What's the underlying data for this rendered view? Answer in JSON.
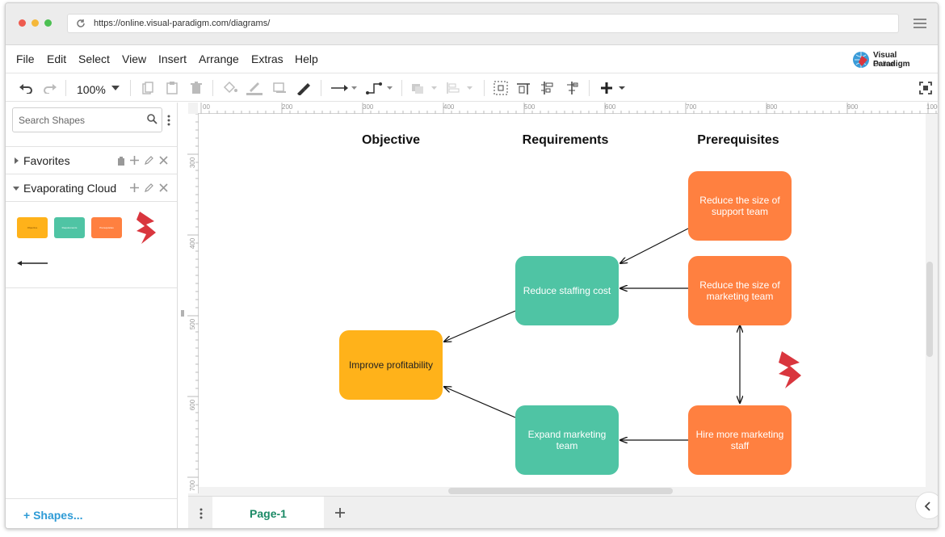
{
  "browser": {
    "url": "https://online.visual-paradigm.com/diagrams/",
    "dots": [
      "#ee5b4f",
      "#f5b83a",
      "#4cc052"
    ]
  },
  "menu": {
    "items": [
      "File",
      "Edit",
      "Select",
      "View",
      "Insert",
      "Arrange",
      "Extras",
      "Help"
    ],
    "logo_line1": "Visual Paradigm",
    "logo_line2": "Online"
  },
  "toolbar": {
    "zoom": "100%"
  },
  "sidebar": {
    "search_placeholder": "Search Shapes",
    "favorites_label": "Favorites",
    "group_label": "Evaporating Cloud",
    "thumb_labels": [
      "Objective",
      "Requirements",
      "Prerequisites"
    ],
    "shapes_link": "+ Shapes..."
  },
  "ruler": {
    "h_labels": [
      "00",
      "200",
      "300",
      "400",
      "500",
      "600",
      "700",
      "800",
      "900",
      "1000"
    ],
    "v_labels": [
      "300",
      "400",
      "500",
      "600",
      "700"
    ]
  },
  "diagram": {
    "headers": {
      "objective": "Objective",
      "requirements": "Requirements",
      "prerequisites": "Prerequisites"
    },
    "nodes": {
      "improve": "Improve profitability",
      "reduce_staffing": "Reduce staffing cost",
      "expand_marketing": "Expand marketing team",
      "reduce_support": "Reduce the size of support team",
      "reduce_marketing": "Reduce the size of marketing team",
      "hire_marketing": "Hire more marketing staff"
    },
    "colors": {
      "teal": "#4fc4a4",
      "orange": "#ff8040",
      "yellow": "#ffb21a",
      "conflict": "#d9363e"
    }
  },
  "pages": {
    "tab_label": "Page-1"
  }
}
